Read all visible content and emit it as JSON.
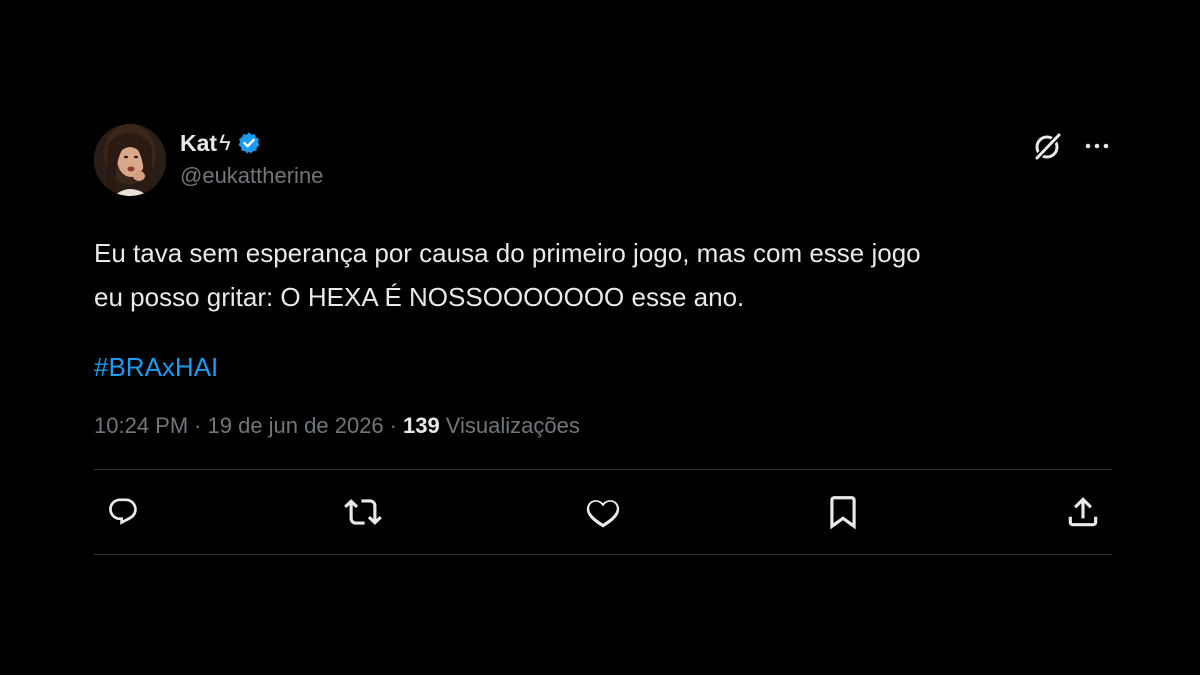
{
  "author": {
    "display_name": "Kat",
    "name_emoji": "ϟ",
    "handle": "@eukattherine",
    "verified": true
  },
  "tweet": {
    "text": "Eu tava sem esperança por causa do primeiro jogo, mas com esse jogo\neu posso gritar: O HEXA É NOSSOOOOOOO esse ano.",
    "hashtag": "#BRAxHAI"
  },
  "meta": {
    "time": "10:24 PM",
    "separator": "·",
    "date": "19 de jun de 2026",
    "views_count": "139",
    "views_label": "Visualizações"
  },
  "icons": {
    "header": [
      "grok-icon",
      "more-icon"
    ],
    "actions": [
      "reply-icon",
      "retweet-icon",
      "like-icon",
      "bookmark-icon",
      "share-icon"
    ]
  },
  "colors": {
    "background": "#000000",
    "text": "#e7e9ea",
    "secondary": "#71767b",
    "accent": "#1d9bf0",
    "divider": "#2f3336"
  }
}
